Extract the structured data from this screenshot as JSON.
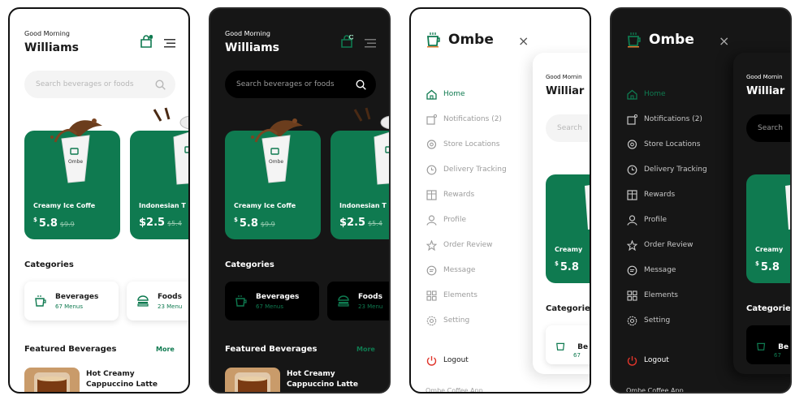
{
  "brand": {
    "accent": "#0f7a50",
    "name": "Ombe"
  },
  "home": {
    "greeting": "Good Morning",
    "user": "Williams",
    "search_placeholder": "Search beverages or foods",
    "products": [
      {
        "name": "Creamy Ice Coffe",
        "currency": "$",
        "price": "5.8",
        "old_price": "$9.9"
      },
      {
        "name": "Indonesian T",
        "price": "$2.5",
        "old_price": "$5.4"
      }
    ],
    "categories_title": "Categories",
    "categories": [
      {
        "name": "Beverages",
        "count": "67 Menus"
      },
      {
        "name": "Foods",
        "count": "23 Menu"
      }
    ],
    "featured_title": "Featured Beverages",
    "featured_more": "More",
    "featured_item_line1": "Hot Creamy",
    "featured_item_line2": "Cappuccino Latte"
  },
  "drawer": {
    "close": "×",
    "items": [
      {
        "label": "Home",
        "icon": "home-icon"
      },
      {
        "label": "Notifications (2)",
        "icon": "bell-icon"
      },
      {
        "label": "Store Locations",
        "icon": "location-pin-icon"
      },
      {
        "label": "Delivery Tracking",
        "icon": "clock-icon"
      },
      {
        "label": "Rewards",
        "icon": "gift-icon"
      },
      {
        "label": "Profile",
        "icon": "user-icon"
      },
      {
        "label": "Order Review",
        "icon": "star-icon"
      },
      {
        "label": "Message",
        "icon": "chat-icon"
      },
      {
        "label": "Elements",
        "icon": "grid-icon"
      },
      {
        "label": "Setting",
        "icon": "gear-icon"
      }
    ],
    "logout": "Logout",
    "footer": "Ombe Coffee App",
    "peek_greeting": "Good Mornin",
    "peek_user": "Williar",
    "peek_search": "Search",
    "peek_product_name": "Creamy",
    "peek_product_currency": "$",
    "peek_product_price": "5.8",
    "peek_categories": "Categorie",
    "peek_cat_label": "Be",
    "peek_cat_count": "67"
  }
}
